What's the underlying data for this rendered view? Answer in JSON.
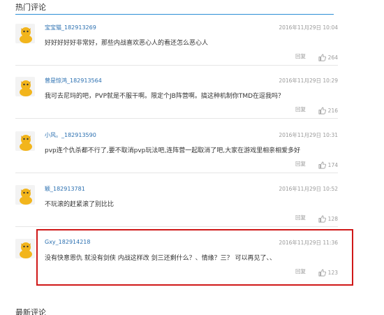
{
  "hot_section": {
    "title": "热门评论"
  },
  "latest_section": {
    "title": "最新评论"
  },
  "actions": {
    "reply_label": "回复"
  },
  "colors": {
    "accent_rule": "#2b8fd6",
    "username": "#2a6fb0",
    "highlight_border": "#d01818"
  },
  "icons": {
    "avatar": "yellow-cartoon-avatar-icon",
    "like": "thumbs-up-icon"
  },
  "comments": [
    {
      "username": "宝宝猫_182913269",
      "time": "2016年11月29日 10:04",
      "content": "好好好好好非常好，那些内战喜欢恶心人的看还怎么恶心人",
      "likes": "264"
    },
    {
      "username": "曾是惊鸿_182913564",
      "time": "2016年11月29日 10:29",
      "content": "我可去尼玛的吧，PVP就是不服干啊。限定个JB阵营啊。搞这种机制你TMD在逗我吗？",
      "likes": "216"
    },
    {
      "username": "小风。_182913590",
      "time": "2016年11月29日 10:31",
      "content": "pvp连个仇杀都不行了,要不取消pvp玩法吧,连阵营一起取消了吧,大家在游戏里相亲相爱多好",
      "likes": "174"
    },
    {
      "username": "颖_182913781",
      "time": "2016年11月29日 10:52",
      "content": "不玩滚的赶紧滚了别比比",
      "likes": "128"
    },
    {
      "username": "Gxy_182914218",
      "time": "2016年11月29日 11:36",
      "content": "没有快意恩仇 就没有剑侠 内战这样改 剑三还剩什么？、情缘？三？ 可以再见了、、",
      "likes": "123"
    }
  ]
}
